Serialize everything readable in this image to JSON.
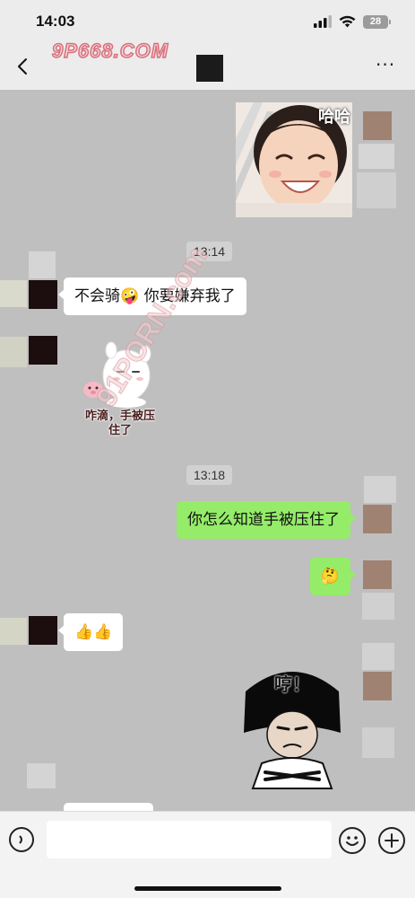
{
  "status_bar": {
    "time": "14:03",
    "battery": "28",
    "icons": [
      "signal-icon",
      "wifi-icon",
      "battery-icon"
    ]
  },
  "nav": {
    "back_icon": "chevron-left-icon",
    "more_label": "···",
    "watermark": "9P668.COM"
  },
  "watermark_diag": "91PORN.com",
  "messages": {
    "photo_sticker_label": "哈哈",
    "time_1": "13:14",
    "msg_1": "不会骑🤪 你要嫌弃我了",
    "bunny_sticker_caption": "咋滴，手被压住了",
    "time_2": "13:18",
    "msg_2": "你怎么知道手被压住了",
    "msg_3": "🤔",
    "msg_4": "👍👍",
    "hum_sticker_label": "哼！"
  },
  "input_bar": {
    "placeholder": "",
    "voice_icon": "voice-icon",
    "emoji_icon": "emoji-icon",
    "add_icon": "plus-icon"
  },
  "colors": {
    "chat_bg": "#bfbfbf",
    "bubble_out": "#95ec69",
    "bubble_in": "#ffffff",
    "bar_bg": "#ececec"
  }
}
